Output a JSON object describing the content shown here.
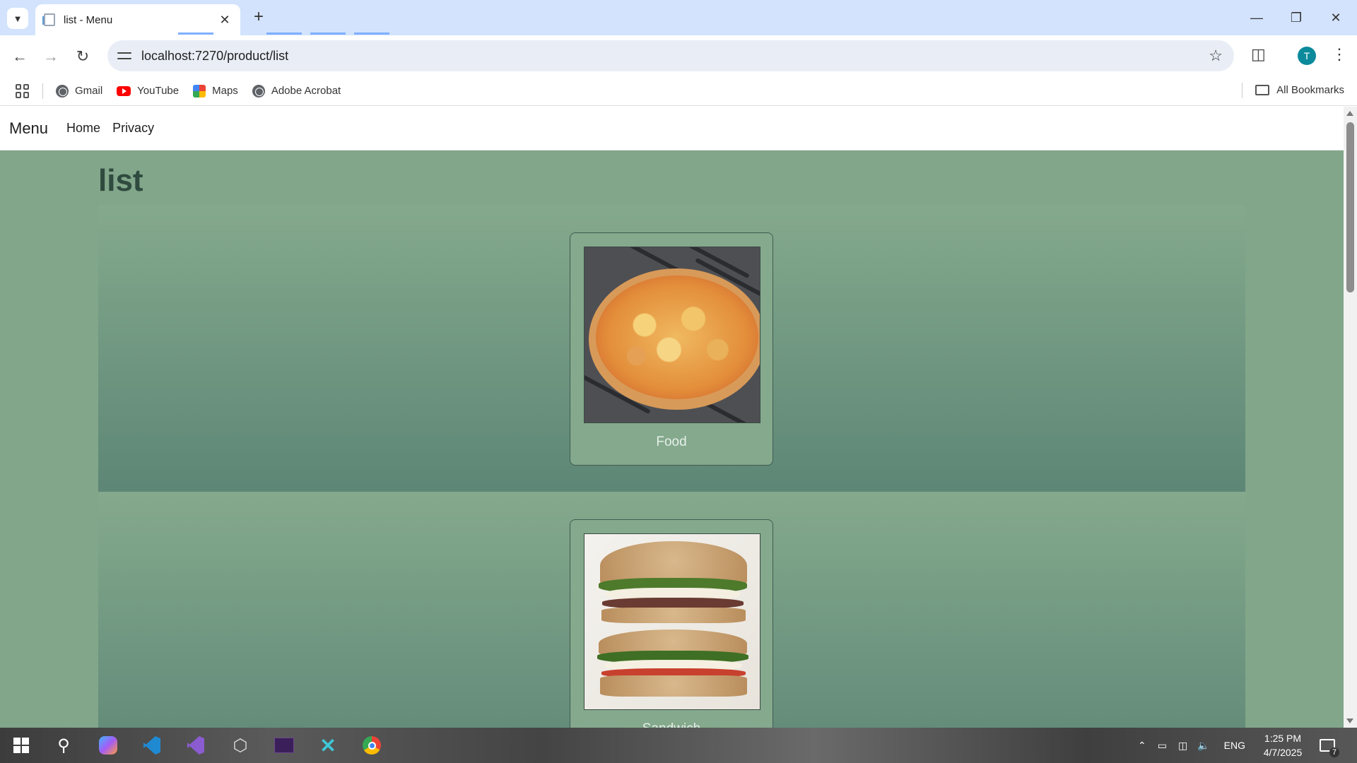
{
  "browser": {
    "tab_title": "list - Menu",
    "url": "localhost:7270/product/list",
    "profile_initial": "T",
    "bookmarks": [
      {
        "label": "Gmail",
        "icon": "globe-icon"
      },
      {
        "label": "YouTube",
        "icon": "youtube-icon"
      },
      {
        "label": "Maps",
        "icon": "maps-icon"
      },
      {
        "label": "Adobe Acrobat",
        "icon": "globe-icon"
      }
    ],
    "all_bookmarks_label": "All Bookmarks"
  },
  "site": {
    "brand": "Menu",
    "nav": [
      {
        "label": "Home"
      },
      {
        "label": "Privacy"
      }
    ],
    "page_title": "list",
    "products": [
      {
        "name": "Food",
        "image": "pizza-image"
      },
      {
        "name": "Sandwich",
        "image": "sandwich-image"
      }
    ]
  },
  "taskbar": {
    "apps": [
      "windows-start",
      "search",
      "copilot",
      "vscode",
      "visual-studio",
      "unity",
      "terminal",
      "cursor",
      "chrome"
    ],
    "language": "ENG",
    "time": "1:25 PM",
    "date": "4/7/2025",
    "notification_count": "7"
  }
}
